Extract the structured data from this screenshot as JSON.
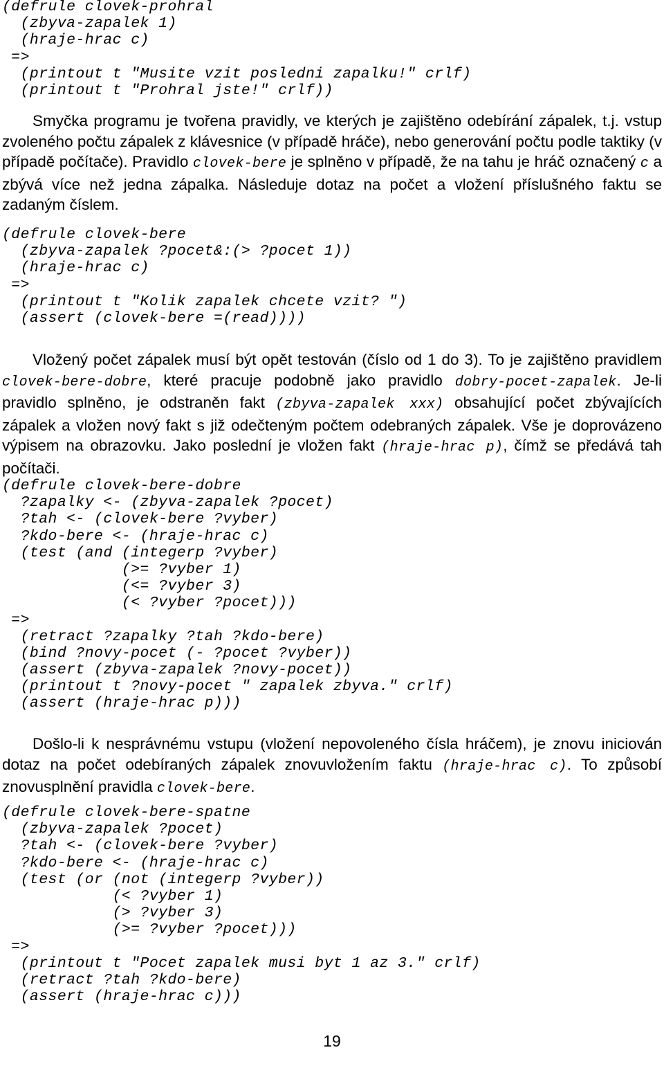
{
  "page": {
    "number": "19",
    "language": "cs"
  },
  "code_blocks": {
    "clovek_prohral": {
      "name": "clovek-prohral",
      "lines": [
        "(defrule clovek-prohral",
        "  (zbyva-zapalek 1)",
        "  (hraje-hrac c)",
        " =>",
        "  (printout t \"Musite vzit posledni zapalku!\" crlf)",
        "  (printout t \"Prohral jste!\" crlf))"
      ]
    },
    "clovek_bere": {
      "name": "clovek-bere",
      "lines": [
        "(defrule clovek-bere",
        "  (zbyva-zapalek ?pocet&:(> ?pocet 1))",
        "  (hraje-hrac c)",
        " =>",
        "  (printout t \"Kolik zapalek chcete vzit? \")",
        "  (assert (clovek-bere =(read))))"
      ]
    },
    "clovek_bere_dobre": {
      "name": "clovek-bere-dobre",
      "lines": [
        "(defrule clovek-bere-dobre",
        "  ?zapalky <- (zbyva-zapalek ?pocet)",
        "  ?tah <- (clovek-bere ?vyber)",
        "  ?kdo-bere <- (hraje-hrac c)",
        "  (test (and (integerp ?vyber)",
        "             (>= ?vyber 1)",
        "             (<= ?vyber 3)",
        "             (< ?vyber ?pocet)))",
        " =>",
        "  (retract ?zapalky ?tah ?kdo-bere)",
        "  (bind ?novy-pocet (- ?pocet ?vyber))",
        "  (assert (zbyva-zapalek ?novy-pocet))",
        "  (printout t ?novy-pocet \" zapalek zbyva.\" crlf)",
        "  (assert (hraje-hrac p)))"
      ]
    },
    "clovek_bere_spatne": {
      "name": "clovek-bere-spatne",
      "lines": [
        "(defrule clovek-bere-spatne",
        "  (zbyva-zapalek ?pocet)",
        "  ?tah <- (clovek-bere ?vyber)",
        "  ?kdo-bere <- (hraje-hrac c)",
        "  (test (or (not (integerp ?vyber))",
        "            (< ?vyber 1)",
        "            (> ?vyber 3)",
        "            (>= ?vyber ?pocet)))",
        " =>",
        "  (printout t \"Pocet zapalek musi byt 1 az 3.\" crlf)",
        "  (retract ?tah ?kdo-bere)",
        "  (assert (hraje-hrac c)))"
      ]
    }
  },
  "paragraphs": {
    "smycka": {
      "part1": "Smyčka programu je tvořena pravidly, ve kterých je zajištěno odebírání zápalek, t.j. vstup zvoleného počtu zápalek z klávesnice (v případě hráče), nebo generování počtu podle taktiky (v případě počítače). Pravidlo ",
      "mono1": "clovek-bere",
      "part2": " je splněno v případě, že na tahu je hráč označený ",
      "mono2": "c",
      "part3": " a zbývá více než jedna zápalka. Následuje dotaz na počet a vložení příslušného faktu se zadaným číslem."
    },
    "vlozeny": {
      "part1": "Vložený počet zápalek musí být opět testován (číslo od 1 do 3). To je zajištěno pravidlem ",
      "mono1": "clovek-bere-dobre",
      "part2": ", které pracuje podobně jako pravidlo ",
      "mono2": "dobry-pocet-zapalek",
      "part3": ". Je-li pravidlo splněno, je odstraněn fakt ",
      "mono3": "(zbyva-zapalek xxx)",
      "part4": " obsahující počet zbývajících zápalek a vložen nový fakt s již odečteným počtem odebraných zápalek. Vše je doprovázeno výpisem na obrazovku. Jako poslední je vložen fakt ",
      "mono4": "(hraje-hrac p)",
      "part5": ", čímž se předává tah počítači."
    },
    "doslo": {
      "part1": "Došlo-li k nesprávnému vstupu (vložení nepovoleného čísla hráčem), je znovu iniciován dotaz na počet odebíraných zápalek znovuvložením faktu ",
      "mono1": "(hraje-hrac c)",
      "part2": ". To způsobí znovusplnění pravidla ",
      "mono2": "clovek-bere",
      "part3": "."
    }
  }
}
